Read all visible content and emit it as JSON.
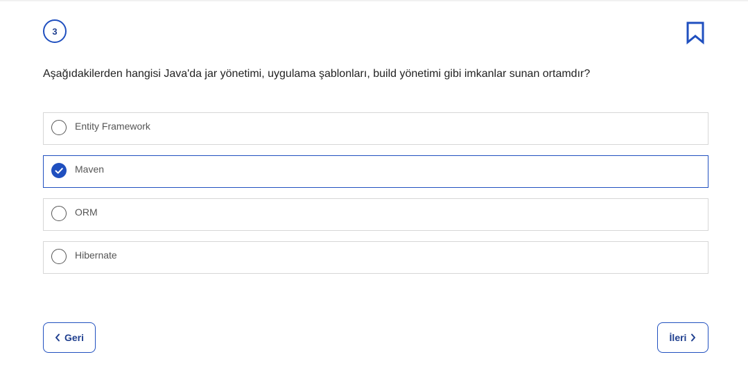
{
  "question": {
    "number": "3",
    "text": "Aşağıdakilerden hangisi Java'da jar yönetimi, uygulama şablonları, build yönetimi gibi imkanlar sunan ortamdır?",
    "bookmark_icon": "bookmark-icon"
  },
  "options": [
    {
      "label": "Entity Framework",
      "selected": false
    },
    {
      "label": "Maven",
      "selected": true
    },
    {
      "label": "ORM",
      "selected": false
    },
    {
      "label": "Hibernate",
      "selected": false
    }
  ],
  "navigation": {
    "back_label": "Geri",
    "next_label": "İleri",
    "back_icon": "chevron-left-icon",
    "next_icon": "chevron-right-icon"
  },
  "colors": {
    "accent": "#1f4fbf",
    "border": "#d6d6d6",
    "text": "#222222",
    "option_text": "#555555"
  }
}
